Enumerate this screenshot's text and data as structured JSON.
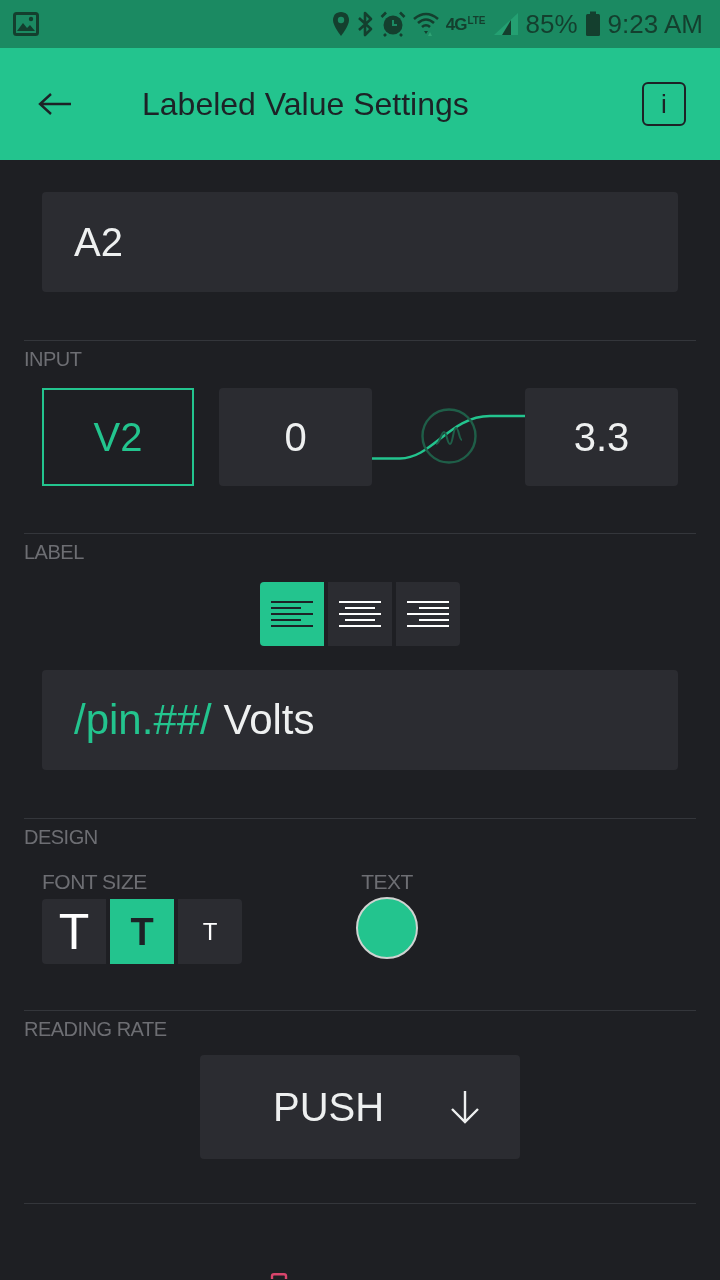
{
  "status_bar": {
    "network_type": "4G",
    "network_subtype": "LTE",
    "battery": "85%",
    "time": "9:23 AM"
  },
  "app_bar": {
    "title": "Labeled Value Settings",
    "info_button": "i"
  },
  "name_field": {
    "value": "A2"
  },
  "input": {
    "heading": "INPUT",
    "pin": "V2",
    "min": "0",
    "max": "3.3"
  },
  "label": {
    "heading": "LABEL",
    "alignments": [
      {
        "kind": "left",
        "selected": true
      },
      {
        "kind": "center",
        "selected": false
      },
      {
        "kind": "right",
        "selected": false
      }
    ],
    "format": [
      {
        "kind": "placeholder",
        "text": "/pin.##/"
      },
      {
        "kind": "plain",
        "text": "Volts"
      }
    ]
  },
  "design": {
    "heading": "DESIGN",
    "font_size": {
      "label": "FONT SIZE",
      "options": [
        {
          "kind": "large",
          "label": "T",
          "selected": false
        },
        {
          "kind": "medium",
          "label": "T",
          "selected": true
        },
        {
          "kind": "small",
          "label": "T",
          "selected": false
        }
      ]
    },
    "text_color": {
      "label": "TEXT",
      "color": "#23c48e"
    }
  },
  "reading_rate": {
    "heading": "READING RATE",
    "value": "PUSH"
  }
}
